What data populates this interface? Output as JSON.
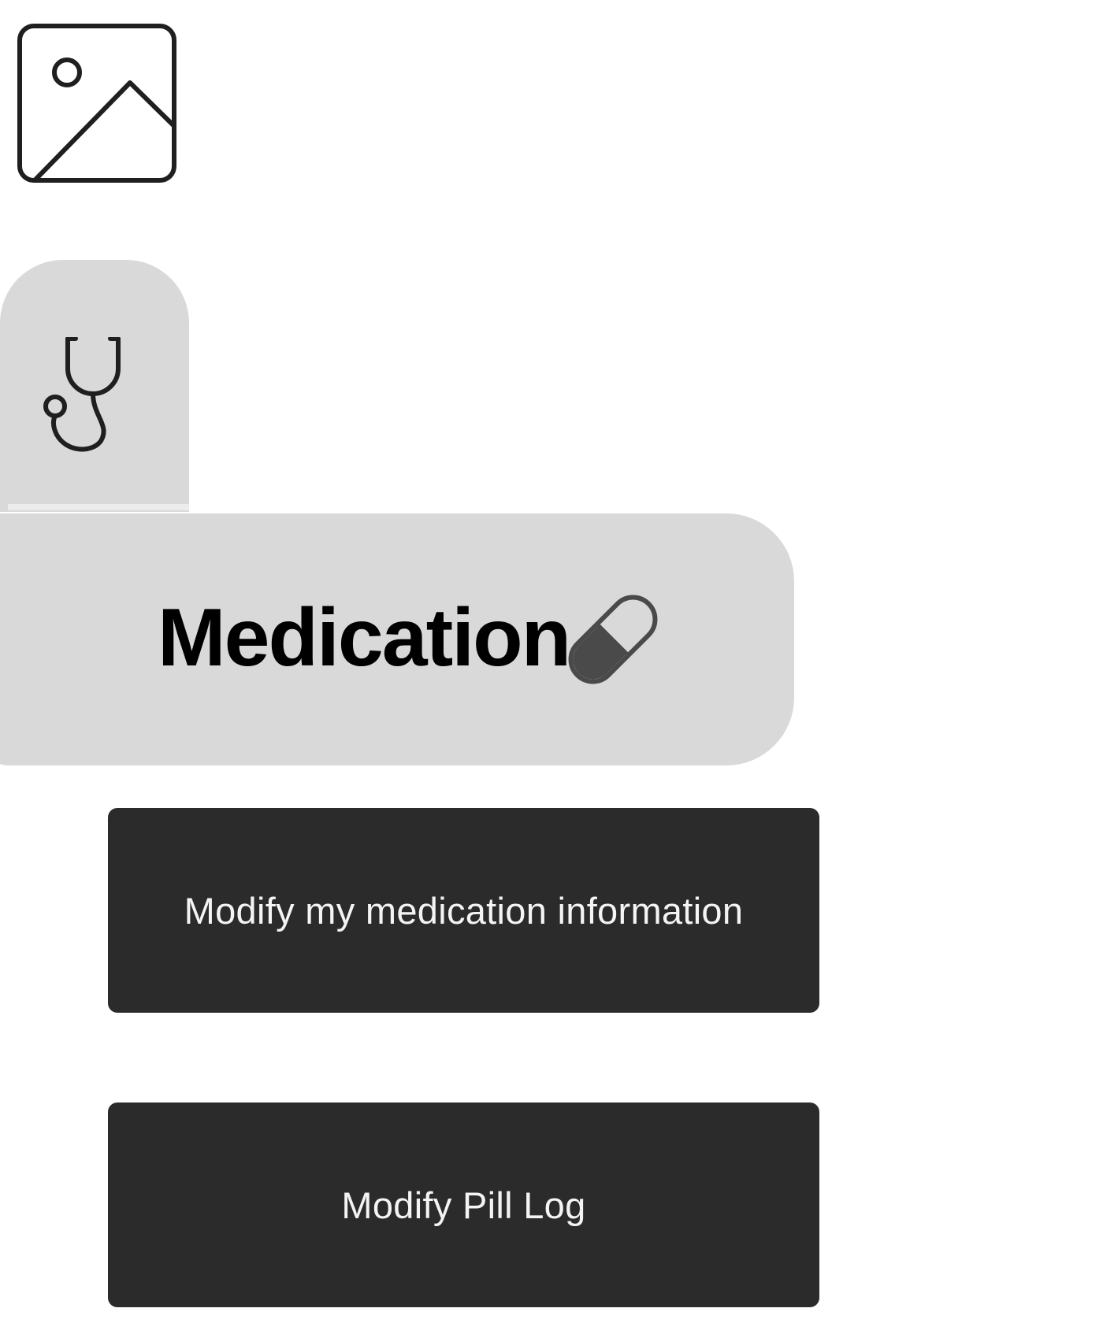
{
  "header": {
    "title": "Medication"
  },
  "icons": {
    "image_placeholder": "image-icon",
    "side_tab": "stethoscope-icon",
    "header": "pill-icon"
  },
  "actions": {
    "modify_medication_label": "Modify my medication information",
    "modify_pill_log_label": "Modify Pill Log"
  },
  "colors": {
    "panel_gray": "#d9d9d9",
    "button_dark": "#2b2b2b",
    "button_text": "#f4f4f4",
    "title_text": "#000000"
  }
}
